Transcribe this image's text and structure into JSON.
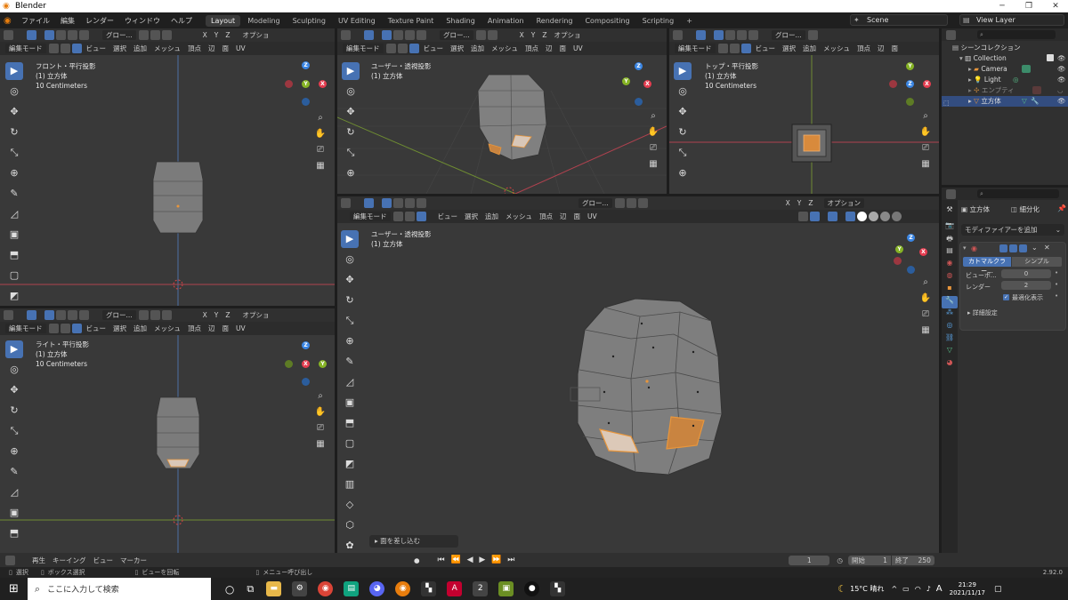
{
  "window": {
    "title": "Blender",
    "minimize": "─",
    "maximize": "❐",
    "close": "✕"
  },
  "menu": {
    "items": [
      "ファイル",
      "編集",
      "レンダー",
      "ウィンドウ",
      "ヘルプ"
    ],
    "workspaces": [
      "Layout",
      "Modeling",
      "Sculpting",
      "UV Editing",
      "Texture Paint",
      "Shading",
      "Animation",
      "Rendering",
      "Compositing",
      "Scripting"
    ],
    "active_workspace": "Layout",
    "add_tab": "+",
    "scene": "Scene",
    "view_layer": "View Layer"
  },
  "viewport_header": {
    "mode": "編集モード",
    "view": "ビュー",
    "select": "選択",
    "add": "追加",
    "mesh": "メッシュ",
    "vertex": "頂点",
    "edge": "辺",
    "face": "面",
    "uv": "UV",
    "global": "グロー...",
    "options": "オプション",
    "options_short": "オプショ",
    "x": "X",
    "y": "Y",
    "z": "Z"
  },
  "viewports": {
    "front": {
      "title": "フロント・平行投影",
      "object": "(1) 立方体",
      "scale": "10 Centimeters"
    },
    "user_top": {
      "title": "ユーザー・透視投影",
      "object": "(1) 立方体"
    },
    "top": {
      "title": "トップ・平行投影",
      "object": "(1) 立方体",
      "scale": "10 Centimeters"
    },
    "right": {
      "title": "ライト・平行投影",
      "object": "(1) 立方体",
      "scale": "10 Centimeters"
    },
    "user_main": {
      "title": "ユーザー・透視投影",
      "object": "(1) 立方体",
      "last_op": "面を差し込む"
    }
  },
  "outliner": {
    "header_search": "",
    "scene_collection": "シーンコレクション",
    "items": [
      {
        "label": "Collection",
        "depth": 1
      },
      {
        "label": "Camera",
        "depth": 2
      },
      {
        "label": "Light",
        "depth": 2
      },
      {
        "label": "エンプティ",
        "depth": 2
      },
      {
        "label": "立方体",
        "depth": 2,
        "selected": true
      }
    ]
  },
  "properties": {
    "object_name": "立方体",
    "modifier_name": "細分化",
    "add_modifier": "モディファイアーを追加",
    "tab_catmull": "カトマルクラー...",
    "tab_simple": "シンプル",
    "viewport_label": "ビューポ...",
    "viewport_value": "0",
    "render_label": "レンダー",
    "render_value": "2",
    "optimal_display": "最適化表示",
    "advanced": "詳細設定"
  },
  "timeline": {
    "playback": "再生",
    "keying": "キーイング",
    "view": "ビュー",
    "marker": "マーカー",
    "current_frame": "1",
    "start_label": "開始",
    "start": "1",
    "end_label": "終了",
    "end": "250"
  },
  "statusbar": {
    "select": "選択",
    "box_select": "ボックス選択",
    "rotate_view": "ビューを回転",
    "call_menu": "メニュー呼び出し",
    "version": "2.92.0"
  },
  "taskbar": {
    "search_placeholder": "ここに入力して検索",
    "weather": "15°C 晴れ",
    "ime": "A",
    "time": "21:29",
    "date": "2021/11/17"
  },
  "colors": {
    "accent": "#4772b3",
    "selected_face": "#d88a3c",
    "x_axis": "#e53d50",
    "y_axis": "#86b325",
    "z_axis": "#3a86e4"
  }
}
